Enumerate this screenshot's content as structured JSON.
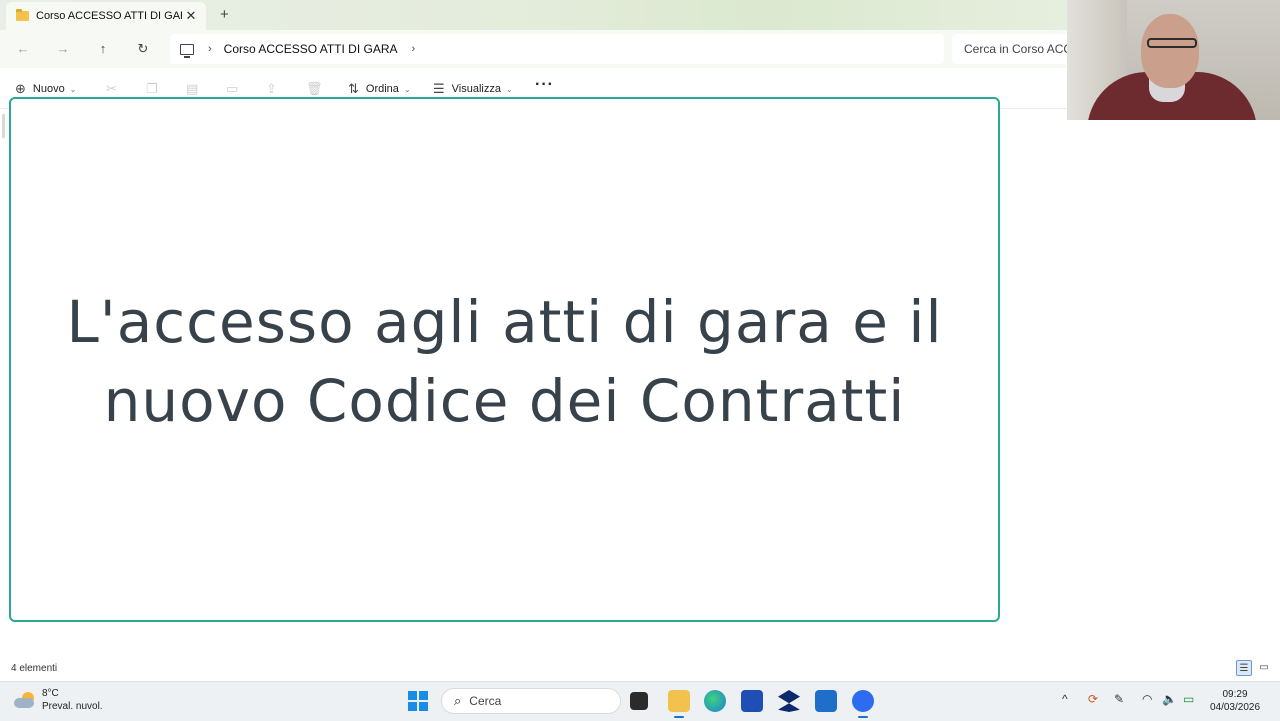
{
  "window": {
    "tab_title": "Corso ACCESSO ATTI DI GARA",
    "tab_close": "✕",
    "new_tab": "+"
  },
  "nav": {
    "back": "←",
    "forward": "→",
    "up": "↑",
    "refresh": "↻",
    "breadcrumb_folder": "Corso ACCESSO ATTI DI GARA",
    "breadcrumb_sep": "›",
    "search_placeholder": "Cerca in Corso ACCESSO ATTI DI GARA"
  },
  "toolbar": {
    "new_label": "Nuovo",
    "sort_label": "Ordina",
    "view_label": "Visualizza",
    "more_label": "···"
  },
  "slide": {
    "title_line1": "L'accesso agli atti di gara e il",
    "title_line2": "nuovo Codice dei Contratti",
    "border_color": "#2aa894"
  },
  "status": {
    "item_count": "4 elementi"
  },
  "taskbar": {
    "weather_temp": "8°C",
    "weather_desc": "Preval. nuvol.",
    "search_label": "Cerca",
    "time": "09:29",
    "date": "04/03/2026"
  },
  "icons": {
    "folder": "folder-icon",
    "weather": "partly-cloudy-icon",
    "windows": "windows-start-icon"
  },
  "colors": {
    "accent": "#2aa894",
    "windows_blue": "#1a8ce6",
    "slide_text": "#38424a"
  }
}
